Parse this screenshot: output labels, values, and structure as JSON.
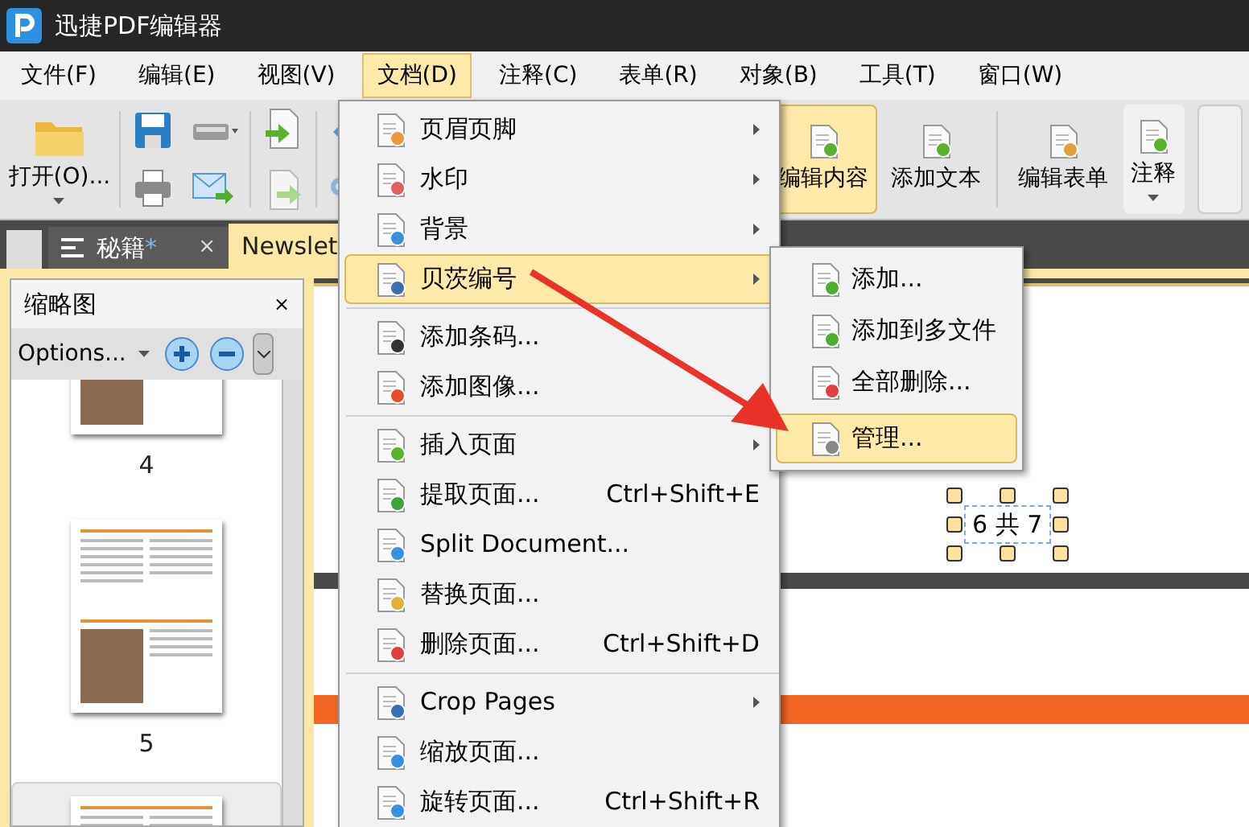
{
  "window": {
    "title": "迅捷PDF编辑器"
  },
  "menubar": [
    {
      "label": "文件(F)",
      "selected": false
    },
    {
      "label": "编辑(E)",
      "selected": false
    },
    {
      "label": "视图(V)",
      "selected": false
    },
    {
      "label": "文档(D)",
      "selected": true
    },
    {
      "label": "注释(C)",
      "selected": false
    },
    {
      "label": "表单(R)",
      "selected": false
    },
    {
      "label": "对象(B)",
      "selected": false
    },
    {
      "label": "工具(T)",
      "selected": false
    },
    {
      "label": "窗口(W)",
      "selected": false
    }
  ],
  "toolbar": {
    "open": {
      "label": "打开(O)...",
      "dropdown": true
    },
    "tools": [
      {
        "label": "编辑内容",
        "selected": true,
        "dropdown": false
      },
      {
        "label": "添加文本",
        "selected": false,
        "dropdown": false
      },
      {
        "label": "编辑表单",
        "selected": false,
        "dropdown": false
      },
      {
        "label": "注释",
        "selected": false,
        "dropdown": true
      }
    ]
  },
  "tabs": [
    {
      "label": "秘籍",
      "modified_mark": "*",
      "selected": false,
      "close": "×"
    },
    {
      "label": "Newslet",
      "selected": true
    }
  ],
  "thumbnail_panel": {
    "title": "缩略图",
    "close": "×",
    "options": "Options...",
    "pages": [
      {
        "label": "4",
        "selected": false
      },
      {
        "label": "5",
        "selected": false
      },
      {
        "selected": true
      }
    ]
  },
  "document": {
    "page_number_field": "6 共 7"
  },
  "menu": [
    {
      "kind": "item",
      "label": "页眉页脚",
      "submenu": true,
      "selected": false
    },
    {
      "kind": "item",
      "label": "水印",
      "submenu": true,
      "selected": false
    },
    {
      "kind": "item",
      "label": "背景",
      "submenu": true,
      "selected": false
    },
    {
      "kind": "item",
      "label": "贝茨编号",
      "submenu": true,
      "selected": true
    },
    {
      "kind": "separator"
    },
    {
      "kind": "item",
      "label": "添加条码...",
      "submenu": false,
      "selected": false
    },
    {
      "kind": "item",
      "label": "添加图像...",
      "submenu": false,
      "selected": false
    },
    {
      "kind": "separator"
    },
    {
      "kind": "item",
      "label": "插入页面",
      "submenu": true,
      "selected": false
    },
    {
      "kind": "item",
      "label": "提取页面...",
      "shortcut": "Ctrl+Shift+E",
      "submenu": false,
      "selected": false
    },
    {
      "kind": "item",
      "label": "Split Document...",
      "submenu": false,
      "selected": false
    },
    {
      "kind": "item",
      "label": "替换页面...",
      "submenu": false,
      "selected": false
    },
    {
      "kind": "item",
      "label": "删除页面...",
      "shortcut": "Ctrl+Shift+D",
      "submenu": false,
      "selected": false
    },
    {
      "kind": "separator"
    },
    {
      "kind": "item",
      "label": "Crop Pages",
      "submenu": true,
      "selected": false
    },
    {
      "kind": "item",
      "label": "缩放页面...",
      "submenu": false,
      "selected": false
    },
    {
      "kind": "item",
      "label": "旋转页面...",
      "shortcut": "Ctrl+Shift+R",
      "submenu": false,
      "selected": false
    }
  ],
  "submenu": [
    {
      "label": "添加...",
      "selected": false
    },
    {
      "label": "添加到多文件",
      "selected": false
    },
    {
      "label": "全部删除...",
      "selected": false
    },
    {
      "label": "管理...",
      "selected": true
    }
  ]
}
